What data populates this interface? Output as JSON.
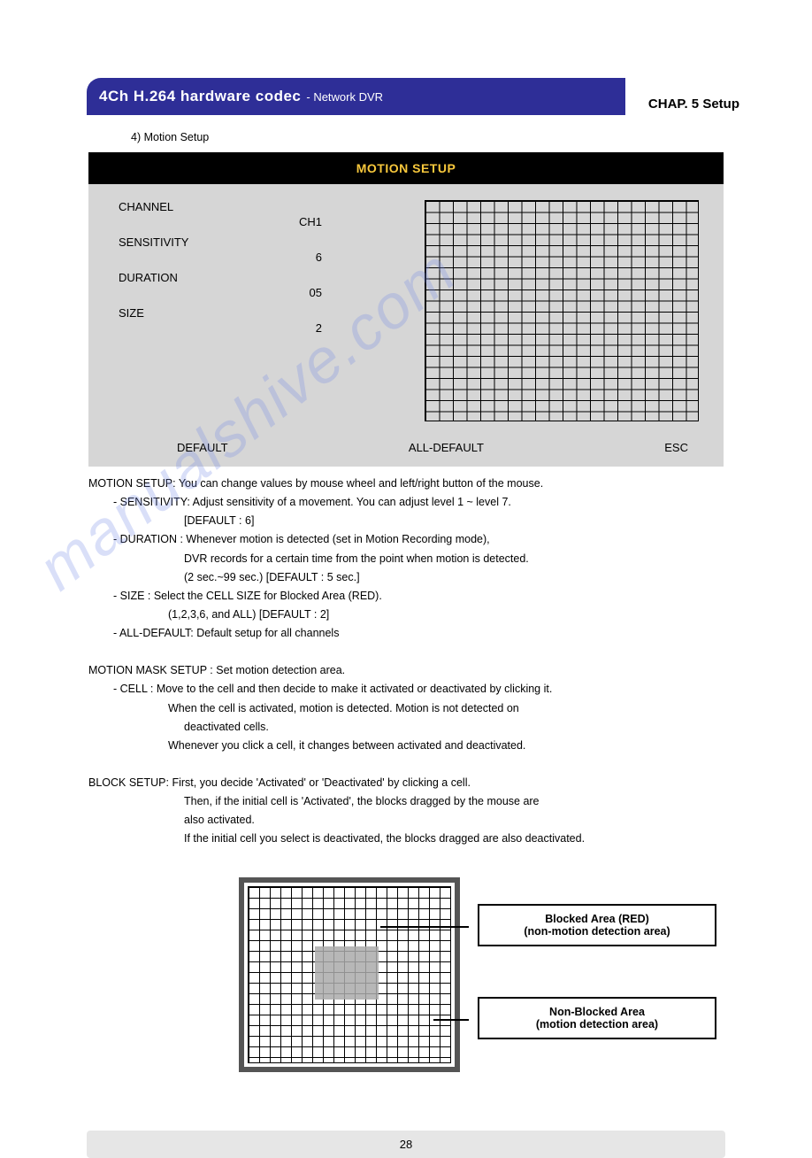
{
  "header": {
    "title_bold": "4Ch H.264 hardware codec",
    "title_sub": "- Network DVR",
    "chapter": "CHAP. 5 Setup"
  },
  "section_num_title": "4) Motion Setup",
  "panel": {
    "title": "MOTION SETUP",
    "labels": {
      "channel": "CHANNEL",
      "sensitivity": "SENSITIVITY",
      "duration": "DURATION",
      "size": "SIZE"
    },
    "values": {
      "channel": "CH1",
      "sensitivity": "6",
      "duration": "05",
      "size": "2"
    },
    "buttons": {
      "default": "DEFAULT",
      "all_default": "ALL-DEFAULT",
      "esc": "ESC"
    }
  },
  "descriptions": {
    "motion_setup_head": "MOTION SETUP: You can change values by mouse wheel and left/right button of the mouse.",
    "sensitivity_line": "- SENSITIVITY: Adjust sensitivity of a movement. You can adjust level 1 ~ level 7.",
    "sensitivity_default": "[DEFAULT : 6]",
    "duration_line": "- DURATION : Whenever motion is detected (set in Motion Recording mode),",
    "duration_line2": "DVR records for a certain time from the point when motion is detected.",
    "duration_default": "(2 sec.~99 sec.) [DEFAULT : 5 sec.]",
    "size_line": "- SIZE : Select the CELL SIZE for Blocked Area (RED).",
    "size_default": "(1,2,3,6, and ALL) [DEFAULT : 2]",
    "all_default_line": "- ALL-DEFAULT: Default setup for all channels",
    "mask_head": "MOTION MASK SETUP : Set motion detection area.",
    "cell_line": "- CELL : Move to the cell and then decide to make it activated or deactivated by clicking it.",
    "cell_line2": "When the cell is activated, motion is detected. Motion is not detected on",
    "cell_line3": "deactivated cells.",
    "cell_line4": "Whenever you click a cell, it changes between activated and deactivated.",
    "block_head": "BLOCK SETUP: First, you decide 'Activated' or 'Deactivated' by clicking a cell.",
    "block_line2": "Then, if the initial cell is 'Activated', the blocks dragged by the mouse are",
    "block_line3": "also activated.",
    "block_line4": "If the initial cell you select is deactivated, the blocks dragged are also deactivated."
  },
  "diagram": {
    "blocked_label_title": "Blocked Area (RED)",
    "blocked_label_sub": "(non-motion detection area)",
    "nonblocked_label_title": "Non-Blocked Area",
    "nonblocked_label_sub": "(motion detection area)"
  },
  "watermark": "manualshive.com",
  "page_number": "28"
}
